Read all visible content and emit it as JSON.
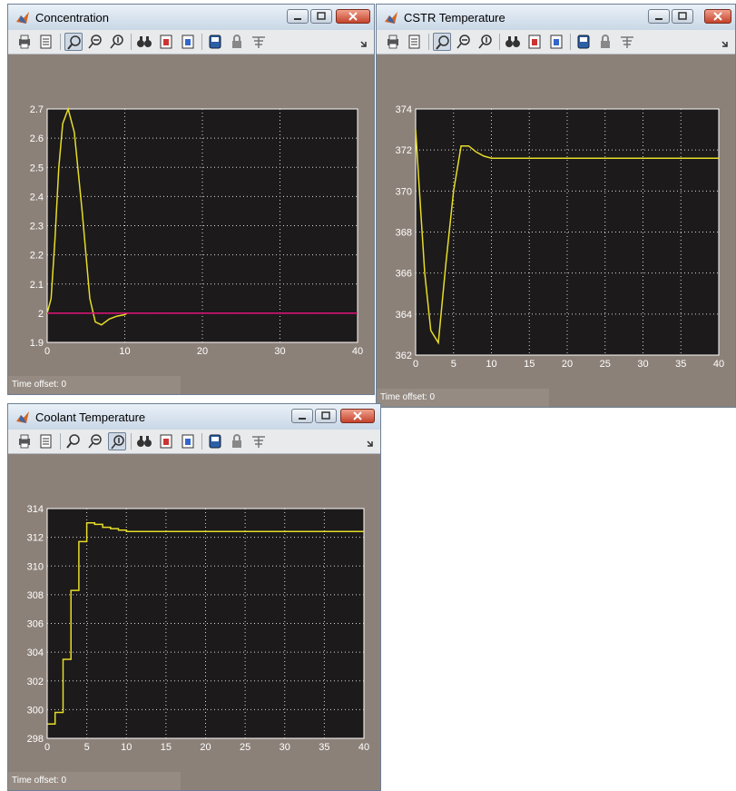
{
  "windows": [
    {
      "title": "Concentration",
      "time_offset_label": "Time offset:",
      "time_offset_value": "0",
      "toolbar_icons": [
        "print-icon",
        "params-icon",
        "zoom-icon",
        "zoom-x-icon",
        "zoom-y-icon",
        "autoscale-icon",
        "save-axes-icon",
        "restore-axes-icon",
        "floating-scope-icon",
        "lock-axes-icon",
        "signal-selection-icon"
      ],
      "chart_data": {
        "type": "line",
        "xlim": [
          0,
          40
        ],
        "ylim": [
          1.9,
          2.7
        ],
        "xticks": [
          0,
          10,
          20,
          30,
          40
        ],
        "yticks": [
          1.9,
          2.0,
          2.1,
          2.2,
          2.3,
          2.4,
          2.5,
          2.6,
          2.7
        ],
        "ytick_labels": [
          "1.9",
          "2",
          "2.1",
          "2.2",
          "2.3",
          "2.4",
          "2.5",
          "2.6",
          "2.7"
        ],
        "grid": true,
        "series": [
          {
            "color": "#e6dd2a",
            "points": [
              [
                0,
                2.0
              ],
              [
                0.5,
                2.05
              ],
              [
                1,
                2.25
              ],
              [
                1.5,
                2.5
              ],
              [
                2,
                2.65
              ],
              [
                2.7,
                2.7
              ],
              [
                3.5,
                2.62
              ],
              [
                4.5,
                2.35
              ],
              [
                5.5,
                2.05
              ],
              [
                6.2,
                1.97
              ],
              [
                7,
                1.96
              ],
              [
                8,
                1.98
              ],
              [
                9,
                1.99
              ],
              [
                10,
                1.995
              ],
              [
                10.3,
                2.0
              ]
            ]
          },
          {
            "color": "#e0147a",
            "points": [
              [
                0,
                2.0
              ],
              [
                40,
                2.0
              ]
            ]
          }
        ]
      }
    },
    {
      "title": "CSTR Temperature",
      "time_offset_label": "Time offset:",
      "time_offset_value": "0",
      "toolbar_icons": [
        "print-icon",
        "params-icon",
        "zoom-icon",
        "zoom-x-icon",
        "zoom-y-icon",
        "autoscale-icon",
        "save-axes-icon",
        "restore-axes-icon",
        "floating-scope-icon",
        "lock-axes-icon",
        "signal-selection-icon"
      ],
      "chart_data": {
        "type": "line",
        "xlim": [
          0,
          40
        ],
        "ylim": [
          362,
          374
        ],
        "xticks": [
          0,
          5,
          10,
          15,
          20,
          25,
          30,
          35,
          40
        ],
        "yticks": [
          362,
          364,
          366,
          368,
          370,
          372,
          374
        ],
        "ytick_labels": [
          "362",
          "364",
          "366",
          "368",
          "370",
          "372",
          "374"
        ],
        "grid": true,
        "series": [
          {
            "color": "#e6dd2a",
            "points": [
              [
                0,
                373
              ],
              [
                0.5,
                370
              ],
              [
                1.2,
                366
              ],
              [
                2,
                363.2
              ],
              [
                3,
                362.6
              ],
              [
                4,
                366.5
              ],
              [
                5,
                370
              ],
              [
                6,
                372.2
              ],
              [
                7,
                372.2
              ],
              [
                8,
                371.9
              ],
              [
                9,
                371.7
              ],
              [
                10,
                371.6
              ],
              [
                15,
                371.6
              ],
              [
                40,
                371.6
              ]
            ]
          }
        ]
      }
    },
    {
      "title": "Coolant Temperature",
      "time_offset_label": "Time offset:",
      "time_offset_value": "0",
      "toolbar_icons": [
        "print-icon",
        "params-icon",
        "zoom-icon",
        "zoom-x-icon",
        "zoom-y-icon",
        "autoscale-icon",
        "save-axes-icon",
        "restore-axes-icon",
        "floating-scope-icon",
        "lock-axes-icon",
        "signal-selection-icon"
      ],
      "chart_data": {
        "type": "line",
        "step": true,
        "xlim": [
          0,
          40
        ],
        "ylim": [
          298,
          314
        ],
        "xticks": [
          0,
          5,
          10,
          15,
          20,
          25,
          30,
          35,
          40
        ],
        "yticks": [
          298,
          300,
          302,
          304,
          306,
          308,
          310,
          312,
          314
        ],
        "ytick_labels": [
          "298",
          "300",
          "302",
          "304",
          "306",
          "308",
          "310",
          "312",
          "314"
        ],
        "grid": true,
        "series": [
          {
            "color": "#e6dd2a",
            "points": [
              [
                0,
                299
              ],
              [
                1,
                299
              ],
              [
                1,
                299.8
              ],
              [
                2,
                299.8
              ],
              [
                2,
                303.5
              ],
              [
                3,
                303.5
              ],
              [
                3,
                308.3
              ],
              [
                4,
                308.3
              ],
              [
                4,
                311.7
              ],
              [
                5,
                311.7
              ],
              [
                5,
                313
              ],
              [
                6,
                313
              ],
              [
                6,
                312.9
              ],
              [
                7,
                312.9
              ],
              [
                7,
                312.7
              ],
              [
                8,
                312.7
              ],
              [
                8,
                312.6
              ],
              [
                9,
                312.6
              ],
              [
                9,
                312.5
              ],
              [
                10,
                312.5
              ],
              [
                10,
                312.4
              ],
              [
                40,
                312.4
              ]
            ]
          }
        ]
      }
    }
  ]
}
